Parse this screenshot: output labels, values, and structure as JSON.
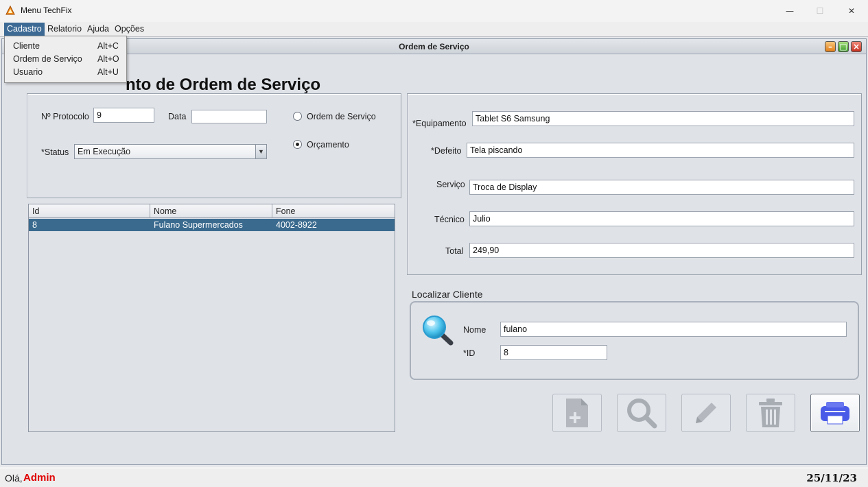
{
  "window": {
    "title": "Menu TechFix",
    "minimize_glyph": "—",
    "maximize_glyph": "☐",
    "close_glyph": "✕"
  },
  "menubar": {
    "items": [
      "Cadastro",
      "Relatorio",
      "Ajuda",
      "Opções"
    ]
  },
  "dropdown": {
    "items": [
      {
        "label": "Cliente",
        "accelerator": "Alt+C"
      },
      {
        "label": "Ordem de Serviço",
        "accelerator": "Alt+O"
      },
      {
        "label": "Usuario",
        "accelerator": "Alt+U"
      }
    ]
  },
  "frame": {
    "title": "Ordem de Serviço",
    "heading": "nto de Ordem de Serviço"
  },
  "order": {
    "protocol_label": "Nº Protocolo",
    "protocol_value": "9",
    "date_label": "Data",
    "date_value": "",
    "status_label": "*Status",
    "status_value": "Em Execução",
    "radio_os_label": "Ordem de Serviço",
    "radio_budget_label": "Orçamento",
    "selected_type": "Orçamento"
  },
  "table": {
    "columns": [
      "Id",
      "Nome",
      "Fone"
    ],
    "rows": [
      {
        "id": "8",
        "nome": "Fulano Supermercados",
        "fone": "4002-8922"
      }
    ]
  },
  "equipment": {
    "equipamento_label": "*Equipamento",
    "equipamento_value": "Tablet S6 Samsung",
    "defeito_label": "*Defeito",
    "defeito_value": "Tela piscando",
    "servico_label": "Serviço",
    "servico_value": "Troca de Display",
    "tecnico_label": "Técnico",
    "tecnico_value": "Julio",
    "total_label": "Total",
    "total_value": "249,90"
  },
  "search": {
    "title": "Localizar Cliente",
    "nome_label": "Nome",
    "nome_value": "fulano",
    "id_label": "*ID",
    "id_value": "8"
  },
  "actions": {
    "icons": [
      "add-document-icon",
      "search-icon",
      "edit-pencil-icon",
      "trash-icon",
      "printer-icon"
    ]
  },
  "status": {
    "greeting": "Olá,",
    "user": "Admin",
    "date": "25/11/23"
  },
  "colors": {
    "menu_active": "#3c6a95",
    "selected_row": "#3a6a8e",
    "user_name": "#e00000",
    "printer_icon": "#4a5be8"
  }
}
